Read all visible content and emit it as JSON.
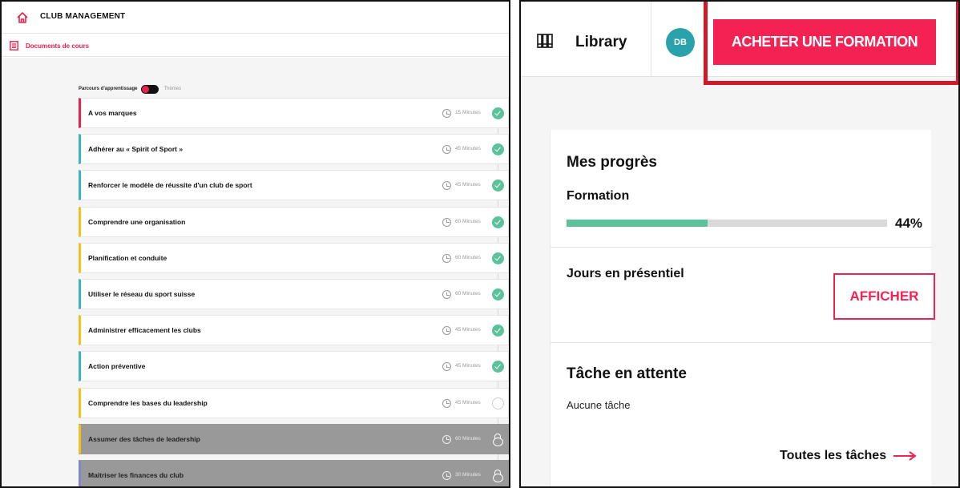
{
  "left": {
    "title": "CLUB MANAGEMENT",
    "docs_link": "Documents de cours",
    "toggle": {
      "left_label": "Parcours d'apprentissage",
      "right_label": "Thèmes"
    },
    "lessons": [
      {
        "title": "A vos marques",
        "duration": "15 Minutes",
        "status": "done",
        "accent": "#e8224e"
      },
      {
        "title": "Adhérer au « Spirit of Sport »",
        "duration": "45 Minutes",
        "status": "done",
        "accent": "#3ab4bf"
      },
      {
        "title": "Renforcer le modèle de réussite d'un club de sport",
        "duration": "45 Minutes",
        "status": "done",
        "accent": "#3ab4bf"
      },
      {
        "title": "Comprendre une organisation",
        "duration": "60 Minutes",
        "status": "done",
        "accent": "#f2c21b"
      },
      {
        "title": "Planification et conduite",
        "duration": "60 Minutes",
        "status": "done",
        "accent": "#f2c21b"
      },
      {
        "title": "Utiliser le réseau du sport suisse",
        "duration": "60 Minutes",
        "status": "done",
        "accent": "#3ab4bf"
      },
      {
        "title": "Administrer efficacement les clubs",
        "duration": "45 Minutes",
        "status": "done",
        "accent": "#f2c21b"
      },
      {
        "title": "Action préventive",
        "duration": "45 Minutes",
        "status": "done",
        "accent": "#3ab4bf"
      },
      {
        "title": "Comprendre les bases du leadership",
        "duration": "45 Minutes",
        "status": "todo",
        "accent": "#f2c21b"
      },
      {
        "title": "Assumer des tâches de leadership",
        "duration": "60 Minutes",
        "status": "locked",
        "accent": "#f2c21b"
      },
      {
        "title": "Maitriser les finances du club",
        "duration": "30 Minutes",
        "status": "locked",
        "accent": "#7f86c9"
      }
    ]
  },
  "right": {
    "library_label": "Library",
    "avatar_initials": "DB",
    "buy_button": "ACHETER UNE FORMATION",
    "progress": {
      "title": "Mes progrès",
      "subtitle": "Formation",
      "percent_label": "44%",
      "value": 0.44
    },
    "days": {
      "title": "Jours en présentiel",
      "button": "AFFICHER"
    },
    "tasks": {
      "title": "Tâche en attente",
      "empty_text": "Aucune tâche",
      "link": "Toutes les tâches"
    }
  },
  "colors": {
    "brand_red": "#f42253",
    "success_green": "#5cc29c",
    "avatar_teal": "#2aa2ab",
    "highlight_red": "#d11929"
  },
  "icons": [
    "home-icon",
    "document-icon",
    "library-icon",
    "clock-icon",
    "check-icon",
    "lock-icon",
    "arrow-right-icon"
  ]
}
